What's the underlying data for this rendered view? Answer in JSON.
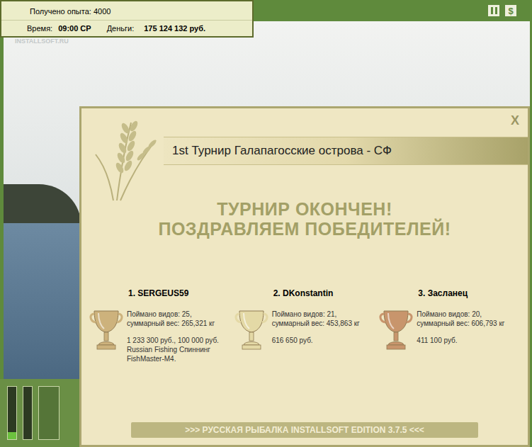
{
  "hud": {
    "experience": "Получено опыта: 4000",
    "time_label": "Время:",
    "time": "09:00 СР",
    "money_label": "Деньги:",
    "money": "175 124 132 руб."
  },
  "watermark": "INSTALLSOFT.RU",
  "toolbar": {
    "money_button": "$"
  },
  "dialog": {
    "title": "1st Турнир Галапагосские острова - СФ",
    "close": "X",
    "heading": [
      "ТУРНИР ОКОНЧЕН!",
      "ПОЗДРАВЛЯЕМ ПОБЕДИТЕЛЕЙ!"
    ],
    "winners": [
      {
        "place": "1. SERGEUS59",
        "color": "#cdb27c",
        "stats": [
          "Поймано видов: 25,",
          "суммарный вес: 265,321 кг"
        ],
        "prizes": [
          "1 233 300 руб., 100 000 руб.",
          "Russian Fishing Спиннинг",
          "FishMaster-M4."
        ]
      },
      {
        "place": "2. DKonstantin",
        "color": "#e4d9a6",
        "stats": [
          "Поймано видов: 21,",
          "суммарный вес: 453,863 кг"
        ],
        "prizes": [
          "616 650 руб."
        ]
      },
      {
        "place": "3. Засланец",
        "color": "#c8956c",
        "stats": [
          "Поймано видов: 20,",
          "суммарный вес: 606,793 кг"
        ],
        "prizes": [
          "411 100 руб."
        ]
      }
    ],
    "footer": ">>> РУССКАЯ РЫБАЛКА INSTALLSOFT EDITION 3.7.5 <<<"
  }
}
